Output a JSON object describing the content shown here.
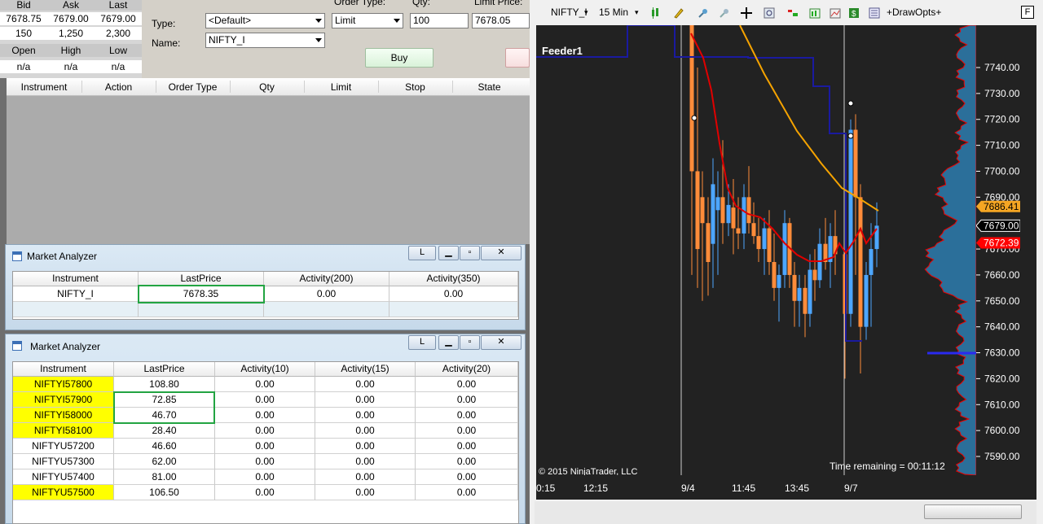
{
  "quote": {
    "headers": [
      "Bid",
      "Ask",
      "Last"
    ],
    "values": [
      "7678.75",
      "7679.00",
      "7679.00"
    ],
    "sizes": [
      "150",
      "1,250",
      "2,300"
    ],
    "headers2": [
      "Open",
      "High",
      "Low"
    ],
    "values2": [
      "n/a",
      "n/a",
      "n/a"
    ]
  },
  "order": {
    "type_label": "Type:",
    "type_value": "<Default>",
    "name_label": "Name:",
    "name_value": "NIFTY_I",
    "order_type_label": "Order Type:",
    "order_type_value": "Limit",
    "qty_label": "Qty:",
    "qty_value": "100",
    "limit_label": "Limit Price:",
    "limit_value": "7678.05",
    "buy_label": "Buy"
  },
  "orders_grid": {
    "columns": [
      "Instrument",
      "Action",
      "Order Type",
      "Qty",
      "Limit",
      "Stop",
      "State"
    ]
  },
  "ma1": {
    "title": "Market Analyzer",
    "link_btn": "L",
    "columns": [
      "Instrument",
      "LastPrice",
      "Activity(200)",
      "Activity(350)"
    ],
    "rows": [
      [
        "NIFTY_I",
        "7678.35",
        "0.00",
        "0.00"
      ]
    ]
  },
  "ma2": {
    "title": "Market Analyzer",
    "link_btn": "L",
    "columns": [
      "Instrument",
      "LastPrice",
      "Activity(10)",
      "Activity(15)",
      "Activity(20)"
    ],
    "rows": [
      [
        "NIFTYI57800",
        "108.80",
        "0.00",
        "0.00",
        "0.00"
      ],
      [
        "NIFTYI57900",
        "72.85",
        "0.00",
        "0.00",
        "0.00"
      ],
      [
        "NIFTYI58000",
        "46.70",
        "0.00",
        "0.00",
        "0.00"
      ],
      [
        "NIFTYI58100",
        "28.40",
        "0.00",
        "0.00",
        "0.00"
      ],
      [
        "NIFTYU57200",
        "46.60",
        "0.00",
        "0.00",
        "0.00"
      ],
      [
        "NIFTYU57300",
        "62.00",
        "0.00",
        "0.00",
        "0.00"
      ],
      [
        "NIFTYU57400",
        "81.00",
        "0.00",
        "0.00",
        "0.00"
      ],
      [
        "NIFTYU57500",
        "106.50",
        "0.00",
        "0.00",
        "0.00"
      ]
    ],
    "highlighted_rows": [
      0,
      1,
      2,
      3,
      7
    ]
  },
  "chart": {
    "instrument": "NIFTY_I",
    "interval": "15 Min",
    "drawopts": "+DrawOpts+",
    "f_button": "F",
    "feed_label": "Feeder1",
    "copyright": "© 2015 NinjaTrader, LLC",
    "time_remaining": "Time remaining = 00:11:12",
    "y_ticks": [
      "7740.00",
      "7730.00",
      "7720.00",
      "7710.00",
      "7700.00",
      "7690.00",
      "7670.00",
      "7660.00",
      "7650.00",
      "7640.00",
      "7630.00",
      "7620.00",
      "7610.00",
      "7600.00",
      "7590.00"
    ],
    "x_ticks": [
      "0:15",
      "12:15",
      "9/4",
      "11:45",
      "13:45",
      "9/7"
    ],
    "price_tags": [
      {
        "label": "7686.41",
        "color": "#f5a623",
        "text_color": "#000000"
      },
      {
        "label": "7679.00",
        "color": "#000000",
        "text_color": "#ffffff"
      },
      {
        "label": "7672.39",
        "color": "#ff0000",
        "text_color": "#ffffff"
      }
    ],
    "colors": {
      "up": "#4da6ff",
      "down": "#ff8c3a",
      "sma_fast": "#e00000",
      "sma_slow": "#f5a300",
      "stepline": "#1a1aa0",
      "volprofile": "#2b6f9a"
    }
  }
}
